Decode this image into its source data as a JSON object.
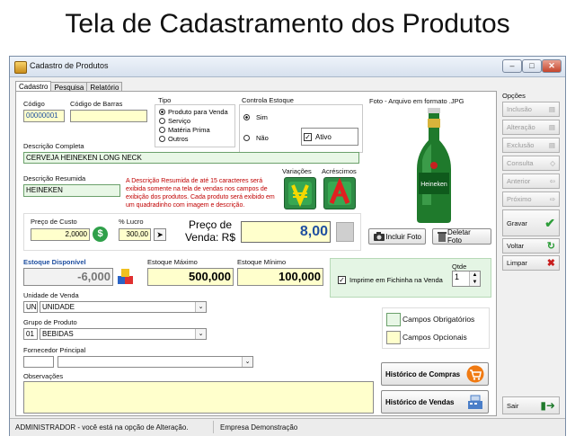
{
  "heading": "Tela de Cadastramento dos Produtos",
  "window": {
    "title": "Cadastro de Produtos"
  },
  "tabs": [
    {
      "label": "Cadastro"
    },
    {
      "label": "Pesquisa"
    },
    {
      "label": "Relatório"
    }
  ],
  "form": {
    "codigo": {
      "label": "Código",
      "value": "00000001"
    },
    "codigo_barras": {
      "label": "Código de Barras",
      "value": ""
    },
    "tipo": {
      "label": "Tipo",
      "options": [
        "Produto para Venda",
        "Serviço",
        "Matéria Prima",
        "Outros"
      ],
      "selected": "Produto para Venda"
    },
    "controla_estoque": {
      "label": "Controla Estoque",
      "options": [
        "Sim",
        "Não"
      ],
      "selected": "Sim"
    },
    "ativo": {
      "label": "Ativo",
      "checked": true
    },
    "descricao_completa": {
      "label": "Descrição Completa",
      "value": "CERVEJA HEINEKEN LONG NECK"
    },
    "descricao_resumida": {
      "label": "Descrição Resumida",
      "value": "HEINEKEN"
    },
    "nota_resumida": "A Descrição Resumida de até 15 caracteres será exibida somente na tela de vendas nos campos de exibição dos produtos. Cada produto será exibido em um quadradinho com imagem e descrição.",
    "variacoes_label": "Variações",
    "acrescimos_label": "Acréscimos",
    "preco_custo": {
      "label": "Preço de Custo",
      "value": "2,0000"
    },
    "lucro": {
      "label": "% Lucro",
      "value": "300,00"
    },
    "preco_venda": {
      "label_1": "Preço de",
      "label_2": "Venda: R$",
      "value": "8,00"
    },
    "foto_label": "Foto - Arquivo em formato .JPG",
    "incluir_foto": "Incluir Foto",
    "deletar_foto": "Deletar Foto",
    "estoque_disponivel": {
      "label": "Estoque Disponível",
      "value": "-6,000"
    },
    "estoque_maximo": {
      "label": "Estoque Máximo",
      "value": "500,000"
    },
    "estoque_minimo": {
      "label": "Estoque Mínimo",
      "value": "100,000"
    },
    "imprime_ficha": {
      "label": "Imprime em Fichinha na Venda",
      "checked": true
    },
    "qtde": {
      "label": "Qtde",
      "value": "1"
    },
    "unidade_venda": {
      "label": "Unidade de Venda",
      "code": "UN",
      "value": "UNIDADE"
    },
    "grupo_produto": {
      "label": "Grupo de Produto",
      "code": "01",
      "value": "BEBIDAS"
    },
    "fornecedor": {
      "label": "Fornecedor Principal",
      "code": "",
      "value": ""
    },
    "observacoes": {
      "label": "Observações",
      "value": ""
    },
    "legend": {
      "obrigatorios": "Campos Obrigatórios",
      "opcionais": "Campos Opcionais"
    },
    "historico_compras": "Histórico de Compras",
    "historico_vendas": "Histórico de Vendas",
    "beer_label": "Heineken"
  },
  "opcoes": {
    "title": "Opções",
    "buttons": [
      {
        "label": "Inclusão",
        "enabled": false
      },
      {
        "label": "Alteração",
        "enabled": false
      },
      {
        "label": "Exclusão",
        "enabled": false
      },
      {
        "label": "Consulta",
        "enabled": false
      },
      {
        "label": "Anterior",
        "enabled": false
      },
      {
        "label": "Próximo",
        "enabled": false
      }
    ],
    "gravar": "Gravar",
    "voltar": "Voltar",
    "limpar": "Limpar",
    "sair": "Sair"
  },
  "status": {
    "user": "ADMINISTRADOR - você está na opção de Alteração.",
    "company": "Empresa Demonstração"
  },
  "colors": {
    "required": "#e8f7e6",
    "optional": "#ffffcc",
    "accent_blue": "#1f4fa0",
    "green_btn": "#2e9e3a",
    "red_x": "#c81e1e"
  }
}
